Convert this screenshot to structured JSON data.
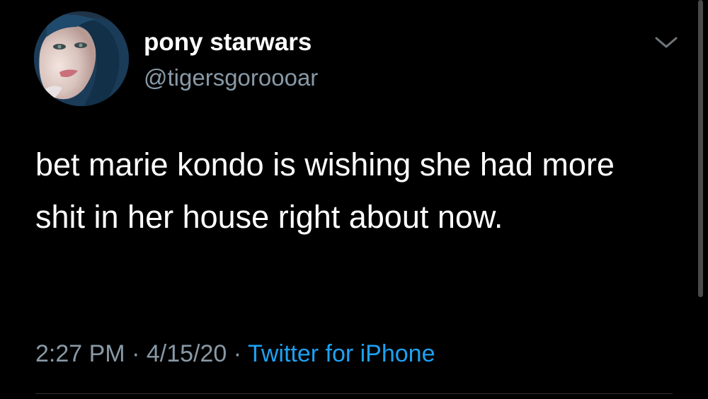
{
  "tweet": {
    "author": {
      "display_name": "pony starwars",
      "handle": "@tigersgoroooar",
      "avatar": "profile-photo"
    },
    "text": "bet marie kondo is wishing she had more shit in her house right about now.",
    "time": "2:27 PM",
    "separator": "·",
    "date": "4/15/20",
    "source": "Twitter for iPhone",
    "menu_icon": "chevron-down-icon"
  },
  "colors": {
    "background": "#000000",
    "text": "#ffffff",
    "secondary_text": "#8899a6",
    "link": "#1da1f2"
  }
}
